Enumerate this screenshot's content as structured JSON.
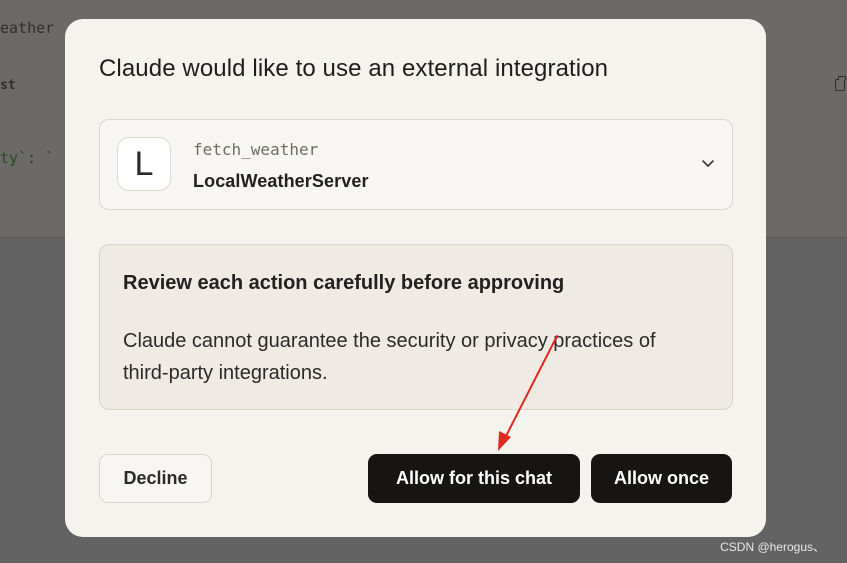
{
  "background": {
    "tab_title": "eather",
    "label": "st",
    "code_prefix": "ty",
    "code_suffix": "`: `"
  },
  "modal": {
    "title": "Claude would like to use an external integration",
    "integration": {
      "avatar_letter": "L",
      "tool_name": "fetch_weather",
      "server_name": "LocalWeatherServer"
    },
    "warning": {
      "title": "Review each action carefully before approving",
      "body": "Claude cannot guarantee the security or privacy practices of third-party integrations."
    },
    "buttons": {
      "decline": "Decline",
      "allow_chat": "Allow for this chat",
      "allow_once": "Allow once"
    }
  },
  "watermark": "CSDN @herogus、",
  "colors": {
    "annotation_arrow": "#e02a20",
    "primary_button": "#161514",
    "modal_bg": "#f5f3ee"
  }
}
